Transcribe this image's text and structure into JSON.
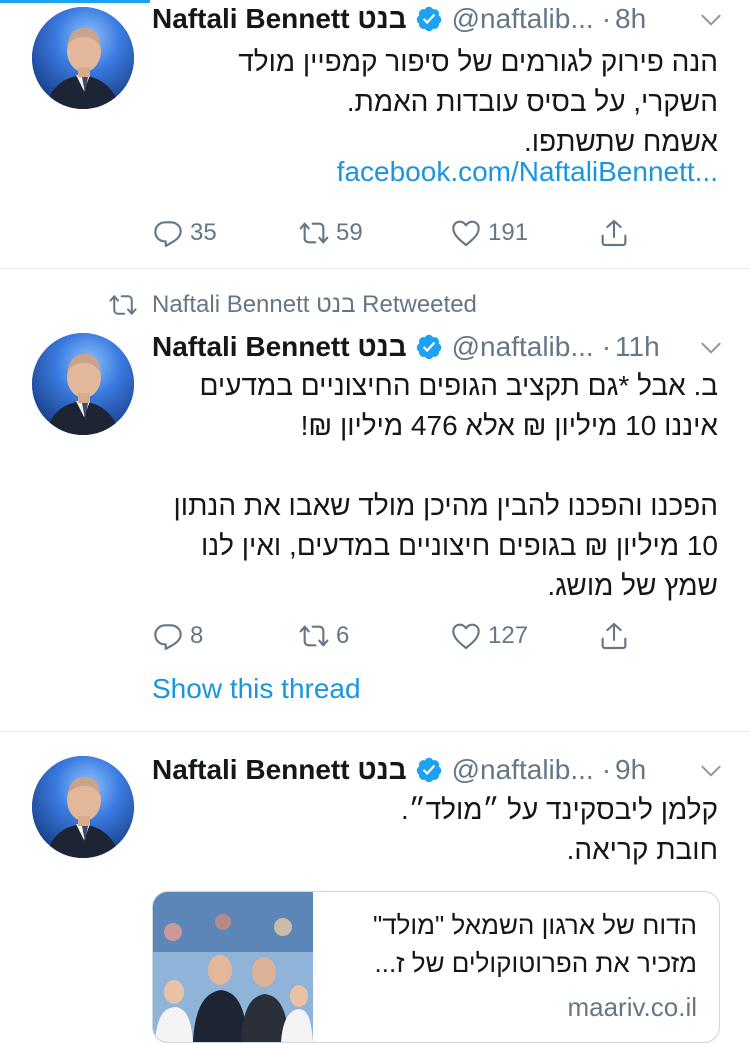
{
  "user": {
    "name": "Naftali Bennett בנט",
    "handle": "@naftalib...",
    "retweet_label": "Naftali Bennett בנט Retweeted"
  },
  "tweets": [
    {
      "time": "8h",
      "text": "הנה פירוק לגורמים של סיפור קמפיין מולד\nהשקרי, על בסיס עובדות האמת.\nאשמח שתשתפו.",
      "link": "facebook.com/NaftaliBennett...",
      "replies": "35",
      "retweets": "59",
      "likes": "191"
    },
    {
      "time": "11h",
      "text": "ב. אבל *גם תקציב הגופים החיצוניים במדעים\nאיננו 10 מיליון ₪ אלא 476 מיליון ₪!\n\nהפכנו והפכנו להבין מהיכן מולד שאבו את הנתון\n10 מיליון ₪ בגופים חיצוניים במדעים, ואין לנו\nשמץ של מושג.",
      "replies": "8",
      "retweets": "6",
      "likes": "127",
      "show_thread": "Show this thread"
    },
    {
      "time": "9h",
      "text": "קלמן ליבסקינד על ״מולד״.\nחובת קריאה.",
      "card_title": "הדוח של ארגון השמאל \"מולד\"\nמזכיר את הפרוטוקולים של ז...",
      "card_domain": "maariv.co.il"
    }
  ],
  "colors": {
    "accent": "#1da1f2",
    "link": "#1b95e0",
    "muted": "#657786",
    "divider": "#e6ecf0"
  },
  "icons": [
    "avatar-photo",
    "verified-badge-icon",
    "chevron-down-icon",
    "reply-icon",
    "retweet-icon",
    "like-icon",
    "share-icon"
  ]
}
